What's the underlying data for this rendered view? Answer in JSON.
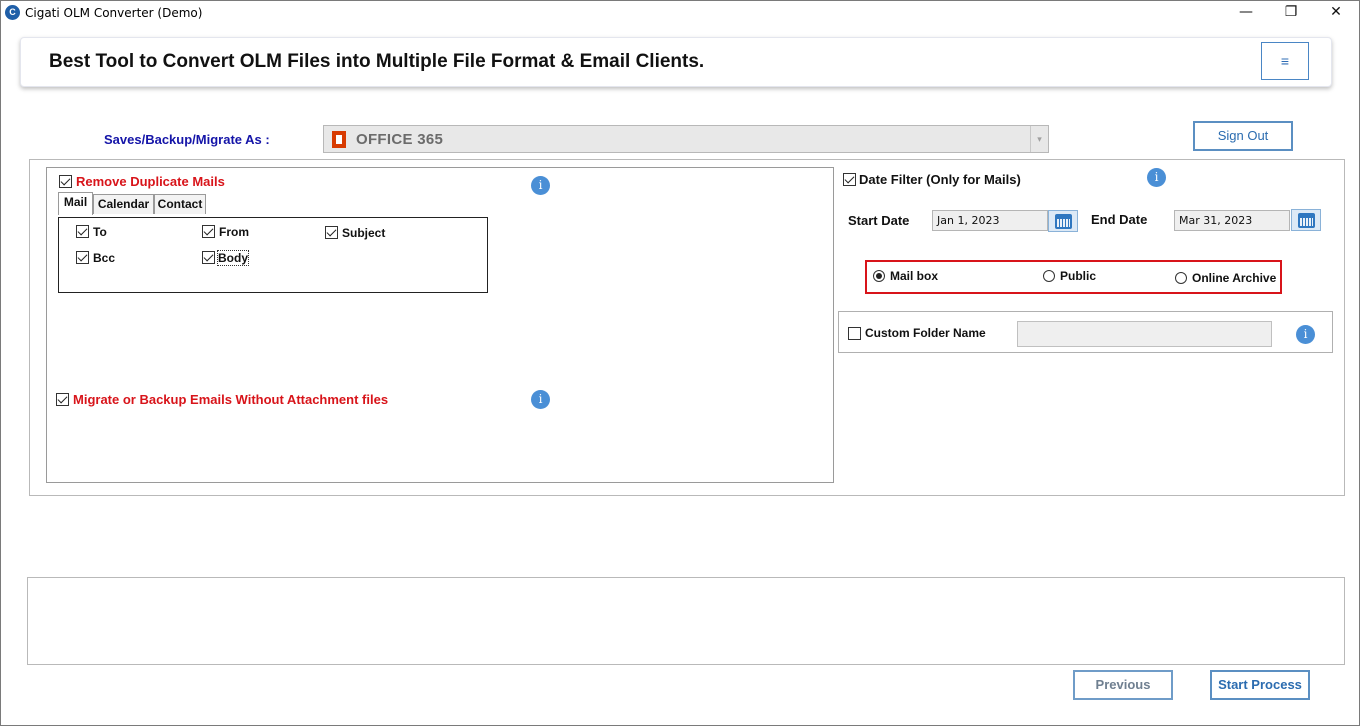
{
  "window": {
    "title": "Cigati OLM Converter (Demo)",
    "icon_letter": "C",
    "minimize_glyph": "—",
    "maximize_glyph": "❐",
    "close_glyph": "✕"
  },
  "header": {
    "title": "Best Tool to Convert OLM Files into Multiple File Format & Email Clients.",
    "menu_glyph": "≡"
  },
  "saves": {
    "label": "Saves/Backup/Migrate As :",
    "selected": "OFFICE 365",
    "arrow_glyph": "▾"
  },
  "sign_out_label": "Sign Out",
  "left": {
    "remove_duplicate": {
      "label": "Remove Duplicate Mails",
      "checked": true
    },
    "tabs": [
      "Mail",
      "Calendar",
      "Contact"
    ],
    "active_tab": "Mail",
    "fields": [
      {
        "label": "To",
        "checked": true
      },
      {
        "label": "From",
        "checked": true
      },
      {
        "label": "Subject",
        "checked": true
      },
      {
        "label": "Bcc",
        "checked": true
      },
      {
        "label": "Body",
        "checked": true
      }
    ],
    "without_attachments": {
      "label": "Migrate or Backup Emails Without Attachment files",
      "checked": true
    },
    "info_glyph": "i"
  },
  "right": {
    "date_filter": {
      "label": "Date Filter  (Only for Mails)",
      "checked": true
    },
    "start_date_label": "Start Date",
    "start_date": "Jan 1, 2023",
    "end_date_label": "End Date",
    "end_date": "Mar 31, 2023",
    "radios": [
      {
        "label": "Mail box",
        "selected": true
      },
      {
        "label": "Public",
        "selected": false
      },
      {
        "label": "Online Archive",
        "selected": false
      }
    ],
    "custom_folder": {
      "label": "Custom Folder Name",
      "checked": false,
      "value": ""
    }
  },
  "footer": {
    "previous_label": "Previous",
    "start_label": "Start Process"
  },
  "colors": {
    "accent_blue": "#2b6cb0",
    "warning_red": "#d8141a",
    "label_navy": "#1414a8"
  }
}
